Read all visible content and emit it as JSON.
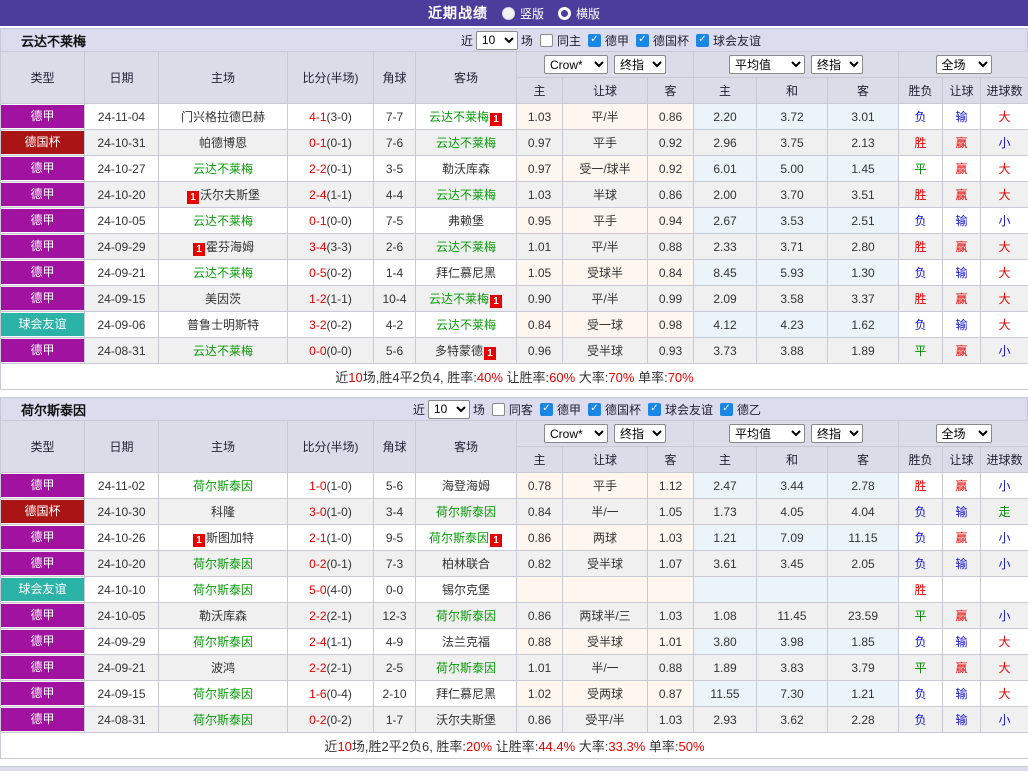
{
  "title_bar": {
    "title": "近期战绩",
    "radio_vertical": "竖版",
    "radio_horizontal": "横版"
  },
  "filter_common": {
    "near": "近",
    "count": "10",
    "games": "场"
  },
  "selects": {
    "bookmaker": "Crow*",
    "final1": "终指",
    "average": "平均值",
    "final2": "终指",
    "scope": "全场"
  },
  "table_headers": {
    "type": "类型",
    "date": "日期",
    "home": "主场",
    "score": "比分(半场)",
    "corner": "角球",
    "away": "客场",
    "odds_home": "主",
    "odds_handicap": "让球",
    "odds_away": "客",
    "avg_home": "主",
    "avg_draw": "和",
    "avg_away": "客",
    "result": "胜负",
    "handicap_result": "让球",
    "goals": "进球数"
  },
  "colors": {
    "topbar": "#4c3d9c",
    "league": {
      "德甲": "#a112a1",
      "德国杯": "#aa1414",
      "球会友谊": "#2ab3a6"
    },
    "team_green": "#0a9a0a",
    "score_red": "#e60000",
    "result_map": {
      "胜": "#e80000",
      "平": "#008800",
      "负": "#1414cc",
      "赢": "#e80000",
      "输": "#1414cc",
      "走": "#008800",
      "大": "#e80000",
      "小": "#1414cc"
    }
  },
  "teams": [
    {
      "name": "云达不莱梅",
      "same_label": "同主",
      "leagues": [
        "德甲",
        "德国杯",
        "球会友谊"
      ],
      "rows": [
        {
          "league": "德甲",
          "date": "24-11-04",
          "home": {
            "name": "门兴格拉德巴赫",
            "green": false
          },
          "score": "4-1",
          "half": "(3-0)",
          "corner": "7-7",
          "away": {
            "name": "云达不莱梅",
            "green": true,
            "suf": "1"
          },
          "odds": [
            "1.03",
            "平/半",
            "0.86"
          ],
          "avg": [
            "2.20",
            "3.72",
            "3.01"
          ],
          "res": "负",
          "asian": "输",
          "goals": "大"
        },
        {
          "league": "德国杯",
          "date": "24-10-31",
          "home": {
            "name": "帕德博恩",
            "green": false
          },
          "score": "0-1",
          "half": "(0-1)",
          "corner": "7-6",
          "away": {
            "name": "云达不莱梅",
            "green": true
          },
          "odds": [
            "0.97",
            "平手",
            "0.92"
          ],
          "avg": [
            "2.96",
            "3.75",
            "2.13"
          ],
          "res": "胜",
          "asian": "赢",
          "goals": "小"
        },
        {
          "league": "德甲",
          "date": "24-10-27",
          "home": {
            "name": "云达不莱梅",
            "green": true
          },
          "score": "2-2",
          "half": "(0-1)",
          "corner": "3-5",
          "away": {
            "name": "勒沃库森",
            "green": false
          },
          "odds": [
            "0.97",
            "受一/球半",
            "0.92"
          ],
          "avg": [
            "6.01",
            "5.00",
            "1.45"
          ],
          "res": "平",
          "asian": "赢",
          "goals": "大"
        },
        {
          "league": "德甲",
          "date": "24-10-20",
          "home": {
            "name": "沃尔夫斯堡",
            "green": false,
            "pre": "1"
          },
          "score": "2-4",
          "half": "(1-1)",
          "corner": "4-4",
          "away": {
            "name": "云达不莱梅",
            "green": true
          },
          "odds": [
            "1.03",
            "半球",
            "0.86"
          ],
          "avg": [
            "2.00",
            "3.70",
            "3.51"
          ],
          "res": "胜",
          "asian": "赢",
          "goals": "大"
        },
        {
          "league": "德甲",
          "date": "24-10-05",
          "home": {
            "name": "云达不莱梅",
            "green": true
          },
          "score": "0-1",
          "half": "(0-0)",
          "corner": "7-5",
          "away": {
            "name": "弗赖堡",
            "green": false
          },
          "odds": [
            "0.95",
            "平手",
            "0.94"
          ],
          "avg": [
            "2.67",
            "3.53",
            "2.51"
          ],
          "res": "负",
          "asian": "输",
          "goals": "小"
        },
        {
          "league": "德甲",
          "date": "24-09-29",
          "home": {
            "name": "霍芬海姆",
            "green": false,
            "pre": "1"
          },
          "score": "3-4",
          "half": "(3-3)",
          "corner": "2-6",
          "away": {
            "name": "云达不莱梅",
            "green": true
          },
          "odds": [
            "1.01",
            "平/半",
            "0.88"
          ],
          "avg": [
            "2.33",
            "3.71",
            "2.80"
          ],
          "res": "胜",
          "asian": "赢",
          "goals": "大"
        },
        {
          "league": "德甲",
          "date": "24-09-21",
          "home": {
            "name": "云达不莱梅",
            "green": true
          },
          "score": "0-5",
          "half": "(0-2)",
          "corner": "1-4",
          "away": {
            "name": "拜仁慕尼黑",
            "green": false
          },
          "odds": [
            "1.05",
            "受球半",
            "0.84"
          ],
          "avg": [
            "8.45",
            "5.93",
            "1.30"
          ],
          "res": "负",
          "asian": "输",
          "goals": "大"
        },
        {
          "league": "德甲",
          "date": "24-09-15",
          "home": {
            "name": "美因茨",
            "green": false
          },
          "score": "1-2",
          "half": "(1-1)",
          "corner": "10-4",
          "away": {
            "name": "云达不莱梅",
            "green": true,
            "suf": "1"
          },
          "odds": [
            "0.90",
            "平/半",
            "0.99"
          ],
          "avg": [
            "2.09",
            "3.58",
            "3.37"
          ],
          "res": "胜",
          "asian": "赢",
          "goals": "大"
        },
        {
          "league": "球会友谊",
          "date": "24-09-06",
          "home": {
            "name": "普鲁士明斯特",
            "green": false
          },
          "score": "3-2",
          "half": "(0-2)",
          "corner": "4-2",
          "away": {
            "name": "云达不莱梅",
            "green": true
          },
          "odds": [
            "0.84",
            "受一球",
            "0.98"
          ],
          "avg": [
            "4.12",
            "4.23",
            "1.62"
          ],
          "res": "负",
          "asian": "输",
          "goals": "大"
        },
        {
          "league": "德甲",
          "date": "24-08-31",
          "home": {
            "name": "云达不莱梅",
            "green": true
          },
          "score": "0-0",
          "half": "(0-0)",
          "corner": "5-6",
          "away": {
            "name": "多特蒙德",
            "green": false,
            "suf": "1"
          },
          "odds": [
            "0.96",
            "受半球",
            "0.93"
          ],
          "avg": [
            "3.73",
            "3.88",
            "1.89"
          ],
          "res": "平",
          "asian": "赢",
          "goals": "小"
        }
      ],
      "summary": [
        {
          "t": "近",
          "red": false
        },
        {
          "t": "10",
          "red": true
        },
        {
          "t": "场,胜4平2负4, 胜率:",
          "red": false
        },
        {
          "t": "40%",
          "red": true
        },
        {
          "t": " 让胜率:",
          "red": false
        },
        {
          "t": "60%",
          "red": true
        },
        {
          "t": " 大率:",
          "red": false
        },
        {
          "t": "70%",
          "red": true
        },
        {
          "t": " 单率:",
          "red": false
        },
        {
          "t": "70%",
          "red": true
        }
      ]
    },
    {
      "name": "荷尔斯泰因",
      "same_label": "同客",
      "leagues": [
        "德甲",
        "德国杯",
        "球会友谊",
        "德乙"
      ],
      "rows": [
        {
          "league": "德甲",
          "date": "24-11-02",
          "home": {
            "name": "荷尔斯泰因",
            "green": true
          },
          "score": "1-0",
          "half": "(1-0)",
          "corner": "5-6",
          "away": {
            "name": "海登海姆",
            "green": false
          },
          "odds": [
            "0.78",
            "平手",
            "1.12"
          ],
          "avg": [
            "2.47",
            "3.44",
            "2.78"
          ],
          "res": "胜",
          "asian": "赢",
          "goals": "小"
        },
        {
          "league": "德国杯",
          "date": "24-10-30",
          "home": {
            "name": "科隆",
            "green": false
          },
          "score": "3-0",
          "half": "(1-0)",
          "corner": "3-4",
          "away": {
            "name": "荷尔斯泰因",
            "green": true
          },
          "odds": [
            "0.84",
            "半/一",
            "1.05"
          ],
          "avg": [
            "1.73",
            "4.05",
            "4.04"
          ],
          "res": "负",
          "asian": "输",
          "goals": "走"
        },
        {
          "league": "德甲",
          "date": "24-10-26",
          "home": {
            "name": "斯图加特",
            "green": false,
            "pre": "1"
          },
          "score": "2-1",
          "half": "(1-0)",
          "corner": "9-5",
          "away": {
            "name": "荷尔斯泰因",
            "green": true,
            "suf": "1"
          },
          "odds": [
            "0.86",
            "两球",
            "1.03"
          ],
          "avg": [
            "1.21",
            "7.09",
            "11.15"
          ],
          "res": "负",
          "asian": "赢",
          "goals": "小"
        },
        {
          "league": "德甲",
          "date": "24-10-20",
          "home": {
            "name": "荷尔斯泰因",
            "green": true
          },
          "score": "0-2",
          "half": "(0-1)",
          "corner": "7-3",
          "away": {
            "name": "柏林联合",
            "green": false
          },
          "odds": [
            "0.82",
            "受半球",
            "1.07"
          ],
          "avg": [
            "3.61",
            "3.45",
            "2.05"
          ],
          "res": "负",
          "asian": "输",
          "goals": "小"
        },
        {
          "league": "球会友谊",
          "date": "24-10-10",
          "home": {
            "name": "荷尔斯泰因",
            "green": true
          },
          "score": "5-0",
          "half": "(4-0)",
          "corner": "0-0",
          "away": {
            "name": "锡尔克堡",
            "green": false
          },
          "odds": [
            "",
            "",
            ""
          ],
          "avg": [
            "",
            "",
            ""
          ],
          "res": "胜",
          "asian": "",
          "goals": ""
        },
        {
          "league": "德甲",
          "date": "24-10-05",
          "home": {
            "name": "勒沃库森",
            "green": false
          },
          "score": "2-2",
          "half": "(2-1)",
          "corner": "12-3",
          "away": {
            "name": "荷尔斯泰因",
            "green": true
          },
          "odds": [
            "0.86",
            "两球半/三",
            "1.03"
          ],
          "avg": [
            "1.08",
            "11.45",
            "23.59"
          ],
          "res": "平",
          "asian": "赢",
          "goals": "小"
        },
        {
          "league": "德甲",
          "date": "24-09-29",
          "home": {
            "name": "荷尔斯泰因",
            "green": true
          },
          "score": "2-4",
          "half": "(1-1)",
          "corner": "4-9",
          "away": {
            "name": "法兰克福",
            "green": false
          },
          "odds": [
            "0.88",
            "受半球",
            "1.01"
          ],
          "avg": [
            "3.80",
            "3.98",
            "1.85"
          ],
          "res": "负",
          "asian": "输",
          "goals": "大"
        },
        {
          "league": "德甲",
          "date": "24-09-21",
          "home": {
            "name": "波鸿",
            "green": false
          },
          "score": "2-2",
          "half": "(2-1)",
          "corner": "2-5",
          "away": {
            "name": "荷尔斯泰因",
            "green": true
          },
          "odds": [
            "1.01",
            "半/一",
            "0.88"
          ],
          "avg": [
            "1.89",
            "3.83",
            "3.79"
          ],
          "res": "平",
          "asian": "赢",
          "goals": "大"
        },
        {
          "league": "德甲",
          "date": "24-09-15",
          "home": {
            "name": "荷尔斯泰因",
            "green": true
          },
          "score": "1-6",
          "half": "(0-4)",
          "corner": "2-10",
          "away": {
            "name": "拜仁慕尼黑",
            "green": false
          },
          "odds": [
            "1.02",
            "受两球",
            "0.87"
          ],
          "avg": [
            "11.55",
            "7.30",
            "1.21"
          ],
          "res": "负",
          "asian": "输",
          "goals": "大"
        },
        {
          "league": "德甲",
          "date": "24-08-31",
          "home": {
            "name": "荷尔斯泰因",
            "green": true
          },
          "score": "0-2",
          "half": "(0-2)",
          "corner": "1-7",
          "away": {
            "name": "沃尔夫斯堡",
            "green": false
          },
          "odds": [
            "0.86",
            "受平/半",
            "1.03"
          ],
          "avg": [
            "2.93",
            "3.62",
            "2.28"
          ],
          "res": "负",
          "asian": "输",
          "goals": "小"
        }
      ],
      "summary": [
        {
          "t": "近",
          "red": false
        },
        {
          "t": "10",
          "red": true
        },
        {
          "t": "场,胜2平2负6, 胜率:",
          "red": false
        },
        {
          "t": "20%",
          "red": true
        },
        {
          "t": " 让胜率:",
          "red": false
        },
        {
          "t": "44.4%",
          "red": true
        },
        {
          "t": " 大率:",
          "red": false
        },
        {
          "t": "33.3%",
          "red": true
        },
        {
          "t": " 单率:",
          "red": false
        },
        {
          "t": "50%",
          "red": true
        }
      ]
    }
  ]
}
